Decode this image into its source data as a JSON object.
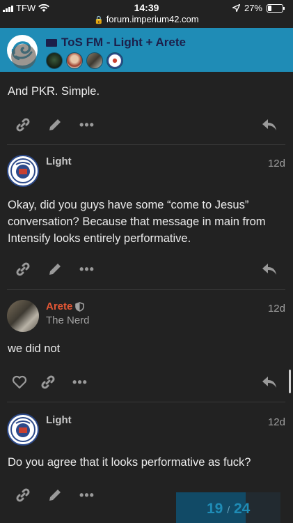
{
  "status": {
    "carrier": "TFW",
    "time": "14:39",
    "battery": "27%",
    "battery_level": 0.27,
    "url": "forum.imperium42.com"
  },
  "header": {
    "title": "ToS FM - Light + Arete",
    "accent_color": "#1f8cb6"
  },
  "posts": [
    {
      "body": "And PKR. Simple."
    },
    {
      "username": "Light",
      "date": "12d",
      "body": "Okay, did you guys have some “come to Jesus” conversation? Because that message in main from Intensify looks entirely performative."
    },
    {
      "username": "Arete",
      "user_title": "The Nerd",
      "date": "12d",
      "body": "we did not",
      "name_color": "#e45735"
    },
    {
      "username": "Light",
      "date": "12d",
      "body": "Do you agree that it looks performative as fuck?"
    }
  ],
  "actions": {
    "more": "•••"
  },
  "progress": {
    "current": "19",
    "separator": "/",
    "total": "24"
  }
}
